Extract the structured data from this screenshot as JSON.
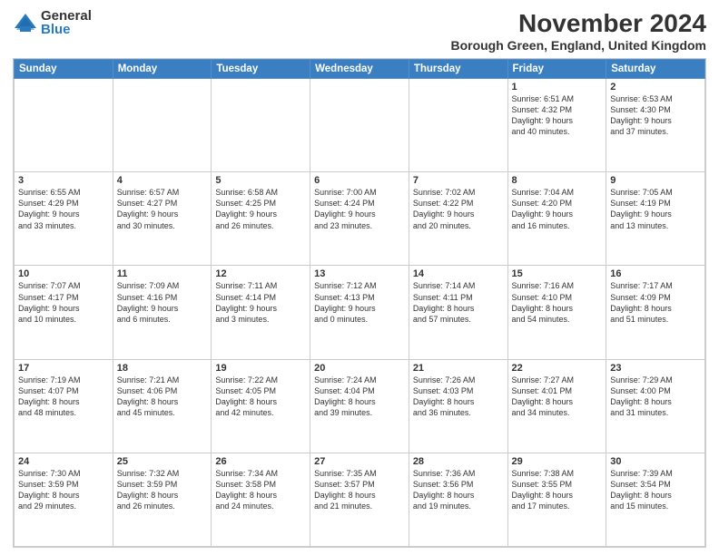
{
  "logo": {
    "general": "General",
    "blue": "Blue"
  },
  "title": "November 2024",
  "location": "Borough Green, England, United Kingdom",
  "days_of_week": [
    "Sunday",
    "Monday",
    "Tuesday",
    "Wednesday",
    "Thursday",
    "Friday",
    "Saturday"
  ],
  "weeks": [
    [
      {
        "day": "",
        "info": ""
      },
      {
        "day": "",
        "info": ""
      },
      {
        "day": "",
        "info": ""
      },
      {
        "day": "",
        "info": ""
      },
      {
        "day": "",
        "info": ""
      },
      {
        "day": "1",
        "info": "Sunrise: 6:51 AM\nSunset: 4:32 PM\nDaylight: 9 hours\nand 40 minutes."
      },
      {
        "day": "2",
        "info": "Sunrise: 6:53 AM\nSunset: 4:30 PM\nDaylight: 9 hours\nand 37 minutes."
      }
    ],
    [
      {
        "day": "3",
        "info": "Sunrise: 6:55 AM\nSunset: 4:29 PM\nDaylight: 9 hours\nand 33 minutes."
      },
      {
        "day": "4",
        "info": "Sunrise: 6:57 AM\nSunset: 4:27 PM\nDaylight: 9 hours\nand 30 minutes."
      },
      {
        "day": "5",
        "info": "Sunrise: 6:58 AM\nSunset: 4:25 PM\nDaylight: 9 hours\nand 26 minutes."
      },
      {
        "day": "6",
        "info": "Sunrise: 7:00 AM\nSunset: 4:24 PM\nDaylight: 9 hours\nand 23 minutes."
      },
      {
        "day": "7",
        "info": "Sunrise: 7:02 AM\nSunset: 4:22 PM\nDaylight: 9 hours\nand 20 minutes."
      },
      {
        "day": "8",
        "info": "Sunrise: 7:04 AM\nSunset: 4:20 PM\nDaylight: 9 hours\nand 16 minutes."
      },
      {
        "day": "9",
        "info": "Sunrise: 7:05 AM\nSunset: 4:19 PM\nDaylight: 9 hours\nand 13 minutes."
      }
    ],
    [
      {
        "day": "10",
        "info": "Sunrise: 7:07 AM\nSunset: 4:17 PM\nDaylight: 9 hours\nand 10 minutes."
      },
      {
        "day": "11",
        "info": "Sunrise: 7:09 AM\nSunset: 4:16 PM\nDaylight: 9 hours\nand 6 minutes."
      },
      {
        "day": "12",
        "info": "Sunrise: 7:11 AM\nSunset: 4:14 PM\nDaylight: 9 hours\nand 3 minutes."
      },
      {
        "day": "13",
        "info": "Sunrise: 7:12 AM\nSunset: 4:13 PM\nDaylight: 9 hours\nand 0 minutes."
      },
      {
        "day": "14",
        "info": "Sunrise: 7:14 AM\nSunset: 4:11 PM\nDaylight: 8 hours\nand 57 minutes."
      },
      {
        "day": "15",
        "info": "Sunrise: 7:16 AM\nSunset: 4:10 PM\nDaylight: 8 hours\nand 54 minutes."
      },
      {
        "day": "16",
        "info": "Sunrise: 7:17 AM\nSunset: 4:09 PM\nDaylight: 8 hours\nand 51 minutes."
      }
    ],
    [
      {
        "day": "17",
        "info": "Sunrise: 7:19 AM\nSunset: 4:07 PM\nDaylight: 8 hours\nand 48 minutes."
      },
      {
        "day": "18",
        "info": "Sunrise: 7:21 AM\nSunset: 4:06 PM\nDaylight: 8 hours\nand 45 minutes."
      },
      {
        "day": "19",
        "info": "Sunrise: 7:22 AM\nSunset: 4:05 PM\nDaylight: 8 hours\nand 42 minutes."
      },
      {
        "day": "20",
        "info": "Sunrise: 7:24 AM\nSunset: 4:04 PM\nDaylight: 8 hours\nand 39 minutes."
      },
      {
        "day": "21",
        "info": "Sunrise: 7:26 AM\nSunset: 4:03 PM\nDaylight: 8 hours\nand 36 minutes."
      },
      {
        "day": "22",
        "info": "Sunrise: 7:27 AM\nSunset: 4:01 PM\nDaylight: 8 hours\nand 34 minutes."
      },
      {
        "day": "23",
        "info": "Sunrise: 7:29 AM\nSunset: 4:00 PM\nDaylight: 8 hours\nand 31 minutes."
      }
    ],
    [
      {
        "day": "24",
        "info": "Sunrise: 7:30 AM\nSunset: 3:59 PM\nDaylight: 8 hours\nand 29 minutes."
      },
      {
        "day": "25",
        "info": "Sunrise: 7:32 AM\nSunset: 3:59 PM\nDaylight: 8 hours\nand 26 minutes."
      },
      {
        "day": "26",
        "info": "Sunrise: 7:34 AM\nSunset: 3:58 PM\nDaylight: 8 hours\nand 24 minutes."
      },
      {
        "day": "27",
        "info": "Sunrise: 7:35 AM\nSunset: 3:57 PM\nDaylight: 8 hours\nand 21 minutes."
      },
      {
        "day": "28",
        "info": "Sunrise: 7:36 AM\nSunset: 3:56 PM\nDaylight: 8 hours\nand 19 minutes."
      },
      {
        "day": "29",
        "info": "Sunrise: 7:38 AM\nSunset: 3:55 PM\nDaylight: 8 hours\nand 17 minutes."
      },
      {
        "day": "30",
        "info": "Sunrise: 7:39 AM\nSunset: 3:54 PM\nDaylight: 8 hours\nand 15 minutes."
      }
    ]
  ]
}
